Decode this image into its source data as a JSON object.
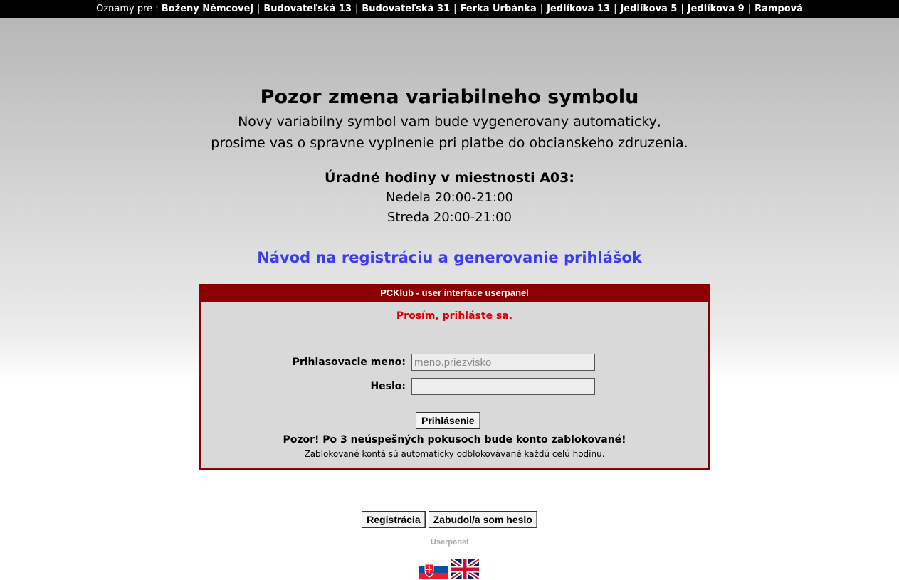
{
  "topbar": {
    "prefix": "Oznamy pre :",
    "buildings": [
      "Boženy Němcovej",
      "Budovateľská 13",
      "Budovateľská 31",
      "Ferka Urbánka",
      "Jedlíkova 13",
      "Jedlíkova 5",
      "Jedlíkova 9",
      "Rampová"
    ],
    "separator": "|"
  },
  "notice": {
    "title": "Pozor zmena variabilneho symbolu",
    "line1": "Novy variabilny symbol vam bude vygenerovany automaticky,",
    "line2": "prosime vas o spravne vyplnenie pri platbe do obcianskeho zdruzenia."
  },
  "office_hours": {
    "title": "Úradné hodiny v miestnosti A03:",
    "slot1": "Nedela 20:00-21:00",
    "slot2": "Streda 20:00-21:00"
  },
  "guide_link": "Návod na registráciu a generovanie prihlášok",
  "login_panel": {
    "header": "PCKlub - user interface userpanel",
    "message": "Prosím, prihláste sa.",
    "username_label": "Prihlasovacie meno:",
    "username_placeholder": "meno.priezvisko",
    "username_value": "",
    "password_label": "Heslo:",
    "password_value": "",
    "login_button": "Prihlásenie",
    "warning_bold": "Pozor! Po 3 neúspešných pokusoch bude konto zablokované!",
    "warning_note": "Zablokované kontá sú automaticky odblokovávané každú celú hodinu."
  },
  "bottom": {
    "register_button": "Registrácia",
    "forgot_button": "Zabudol/a som heslo",
    "footer_label": "Userpanel"
  },
  "languages": [
    {
      "icon": "flag-slovakia-icon",
      "name": "sk"
    },
    {
      "icon": "flag-uk-icon",
      "name": "en"
    }
  ],
  "colors": {
    "panel_border": "#8b0000",
    "panel_header_bg": "#8b0000",
    "panel_message": "#e00000",
    "link": "#3b3bf2",
    "topbar_bg": "#000000"
  }
}
